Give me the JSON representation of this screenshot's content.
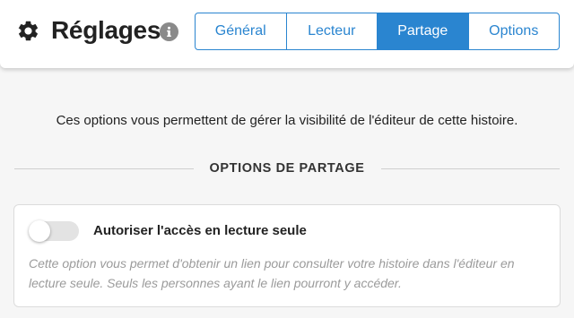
{
  "header": {
    "title": "Réglages",
    "title_icon": "gear-icon",
    "info_icon": "info-icon",
    "tabs": [
      {
        "label": "Général",
        "active": false
      },
      {
        "label": "Lecteur",
        "active": false
      },
      {
        "label": "Partage",
        "active": true
      },
      {
        "label": "Options",
        "active": false
      }
    ]
  },
  "main": {
    "intro": "Ces options vous permettent de gérer la visibilité de l'éditeur de cette histoire.",
    "section_title": "OPTIONS DE PARTAGE",
    "readonly_option": {
      "label": "Autoriser l'accès en lecture seule",
      "enabled": false,
      "description": "Cette option vous permet d'obtenir un lien pour consulter votre histoire dans l'éditeur en lecture seule. Seuls les personnes ayant le lien pourront y accéder."
    }
  },
  "colors": {
    "accent": "#2a85d0",
    "background": "#f6f6f6",
    "muted_text": "#9b9b9b"
  }
}
